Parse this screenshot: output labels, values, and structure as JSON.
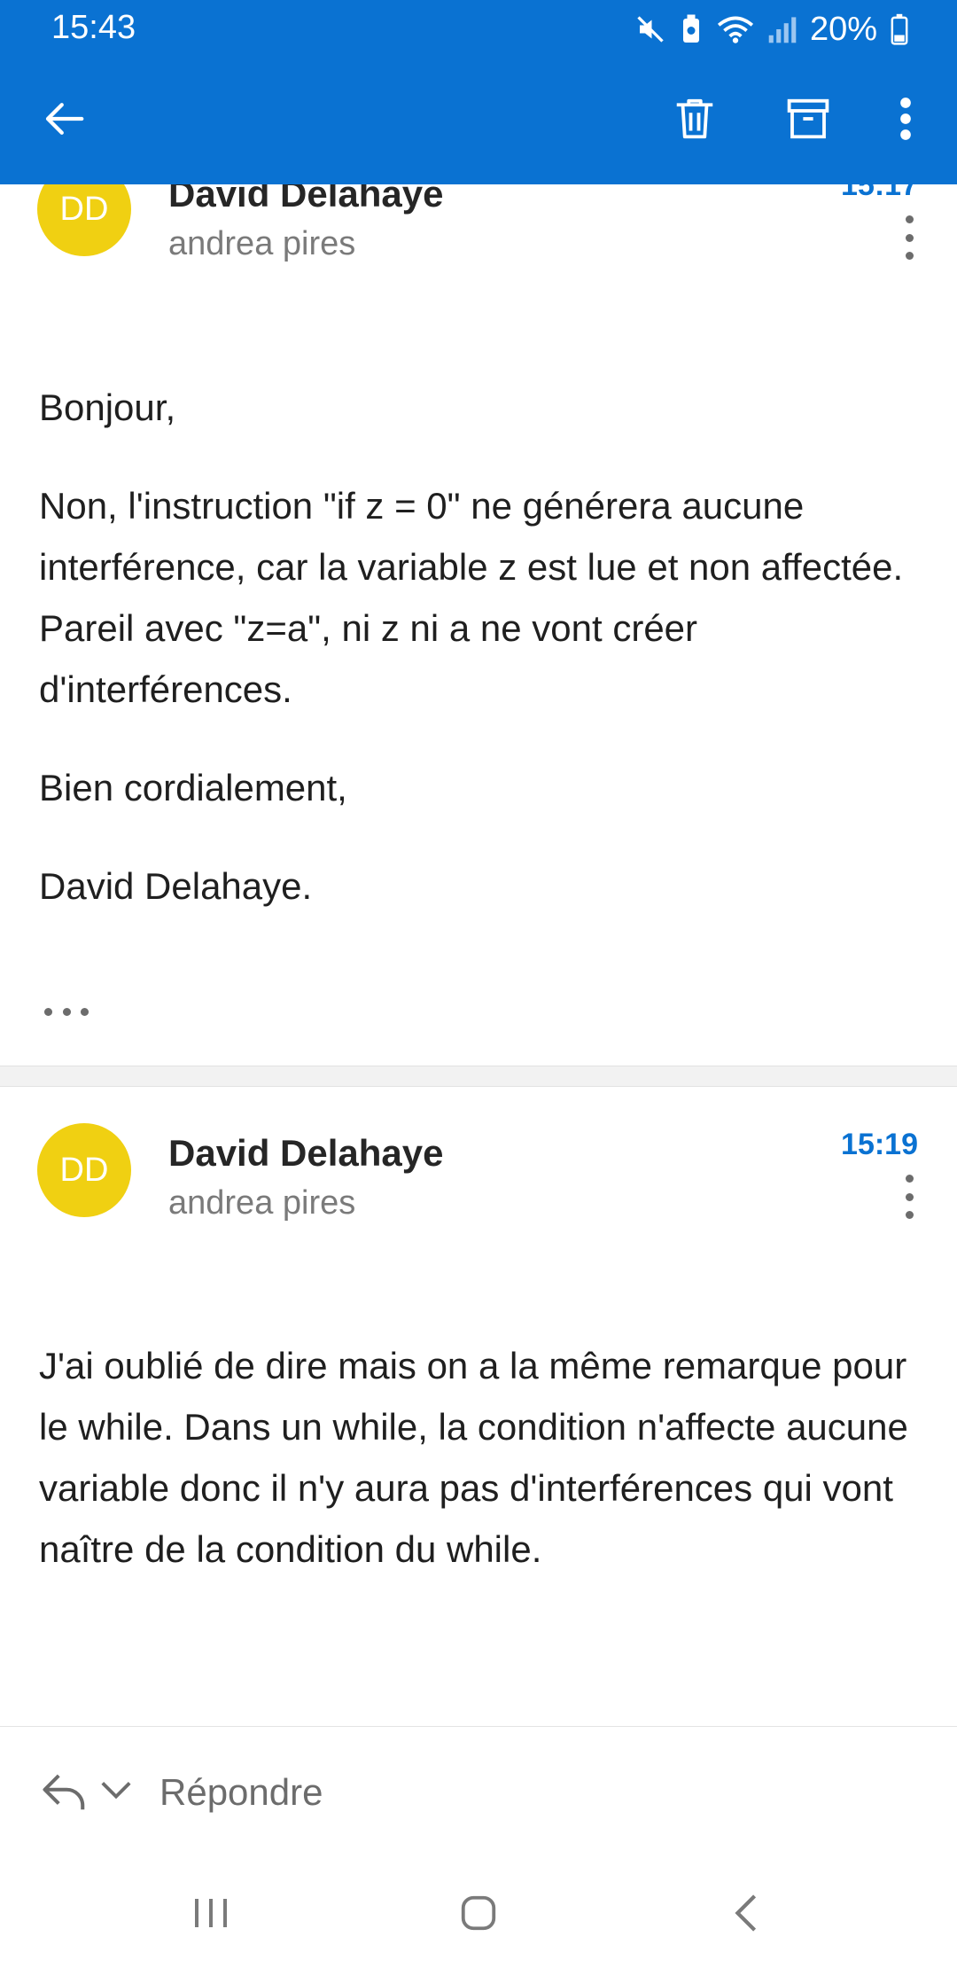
{
  "status_bar": {
    "time": "15:43",
    "battery": "20%",
    "icons": [
      "mute-icon",
      "battery-saver-icon",
      "wifi-icon",
      "signal-icon",
      "battery-icon"
    ]
  },
  "app_bar": {
    "icons": [
      "back-arrow-icon",
      "delete-icon",
      "archive-icon",
      "more-vert-icon"
    ]
  },
  "messages": [
    {
      "avatar_initials": "DD",
      "sender": "David Delahaye",
      "recipient": "andrea pires",
      "time": "15:17",
      "body": [
        "Bonjour,",
        "Non, l'instruction \"if z = 0\" ne générera aucune interférence, car la variable z est lue et non affectée. Pareil avec \"z=a\", ni z ni a ne vont créer d'interférences.",
        "Bien cordialement,",
        "David Delahaye."
      ]
    },
    {
      "avatar_initials": "DD",
      "sender": "David Delahaye",
      "recipient": "andrea pires",
      "time": "15:19",
      "body": [
        "J'ai oublié de dire mais on a la même remarque pour le while. Dans un while, la condition n'affecte aucune variable donc il n'y aura pas d'interférences qui vont naître de la condition du while."
      ]
    }
  ],
  "reply_bar": {
    "label": "Répondre"
  },
  "colors": {
    "primary": "#0a72d2",
    "avatar": "#f0d012"
  }
}
